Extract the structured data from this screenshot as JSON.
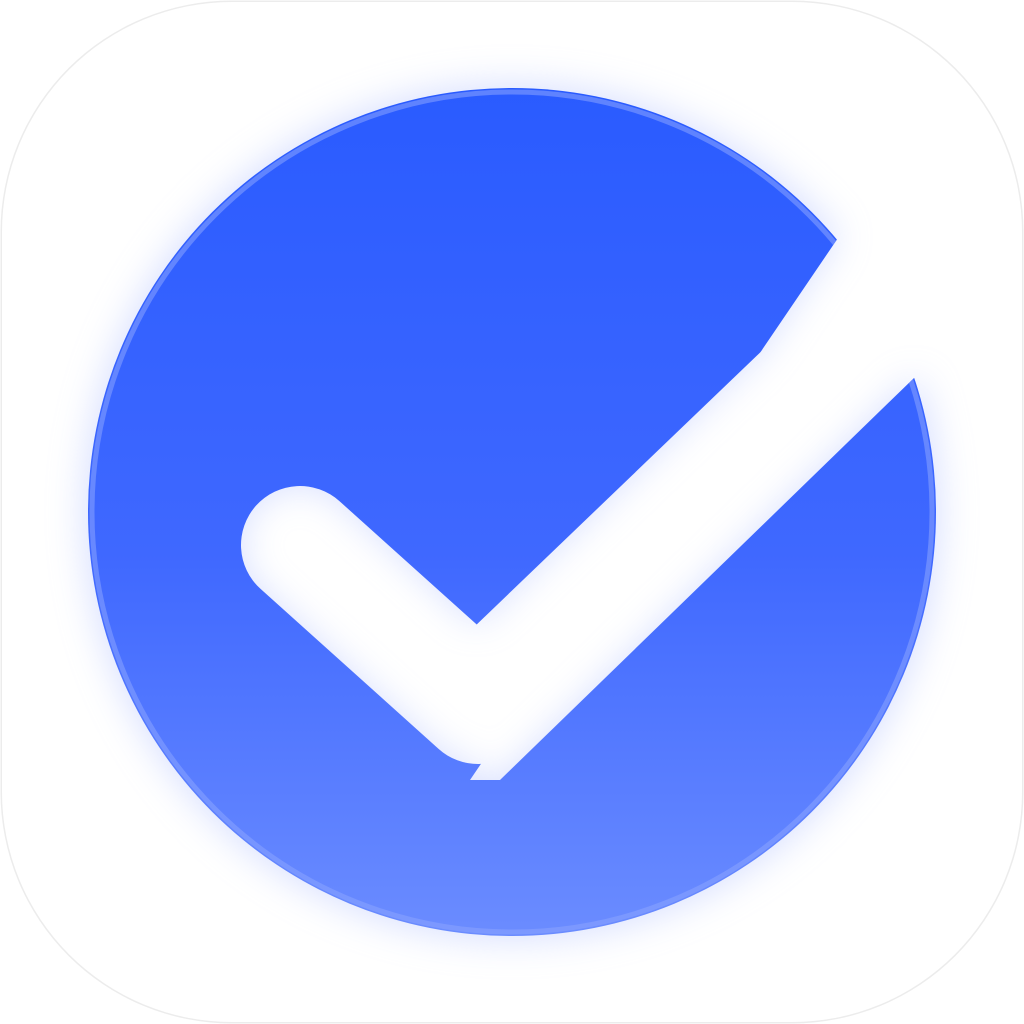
{
  "app_icon": {
    "shape": "rounded-square",
    "background_color": "#ffffff",
    "border_color": "#ececec",
    "glyph": {
      "icon": "check-circle-icon",
      "gradient_top_color": "#2a5bff",
      "gradient_bottom_color": "#6b8cff",
      "rim_color": "#8aa4ff",
      "glow_color": "#b9c7ff",
      "cutout_color": "#ffffff"
    }
  }
}
